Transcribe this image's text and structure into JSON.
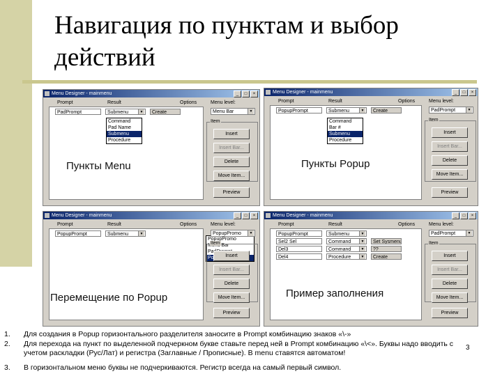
{
  "slide": {
    "title_line1": "Навигация по пунктам и выбор",
    "title_line2": "действий",
    "number": "3",
    "accent_color": "#d5d3a6",
    "rule_color": "#cac78e"
  },
  "windows": [
    {
      "title": "Menu Designer - mainmenu",
      "caption": "Пункты Menu",
      "labels": {
        "prompt": "Prompt",
        "result": "Result",
        "options": "Options",
        "menu_level": "Menu level:",
        "item": "Item"
      },
      "rows": [
        {
          "prompt": "PadPrompt",
          "result": "Submenu",
          "extra": "Create"
        }
      ],
      "dropdown": [
        "Command",
        "Pad Name",
        "Submenu",
        "Procedure"
      ],
      "dropdown_selected": 2,
      "menu_level_value": "Menu Bar",
      "buttons": [
        "Insert",
        "Insert Bar...",
        "Delete",
        "Move Item...",
        "Preview"
      ]
    },
    {
      "title": "Menu Designer - mainmenu",
      "caption": "Пункты Popup",
      "labels": {
        "prompt": "Prompt",
        "result": "Result",
        "options": "Options",
        "menu_level": "Menu level:",
        "item": "Item"
      },
      "rows": [
        {
          "prompt": "PopupPrompt",
          "result": "Submenu",
          "extra": "Create"
        }
      ],
      "dropdown": [
        "Command",
        "Bar #",
        "Submenu",
        "Procedure"
      ],
      "dropdown_selected": 2,
      "menu_level_value": "PadPrompt",
      "buttons": [
        "Insert",
        "Insert Bar...",
        "Delete",
        "Move Item...",
        "Preview"
      ]
    },
    {
      "title": "Menu Designer - mainmenu",
      "caption": "Перемещение по Popup",
      "labels": {
        "prompt": "Prompt",
        "result": "Result",
        "options": "Options",
        "menu_level": "Menu level:",
        "item": "Item"
      },
      "rows": [
        {
          "prompt": "PopupPrompt",
          "result": "Submenu",
          "extra": ""
        }
      ],
      "dropdown": [
        "PopupPromo",
        "Menu Bar",
        "PadPrompt",
        "PopupPromo"
      ],
      "dropdown_selected": 3,
      "menu_level_value": "PopupPromo",
      "buttons": [
        "Insert",
        "Insert Bar...",
        "Delete",
        "Move Item...",
        "Preview"
      ]
    },
    {
      "title": "Menu Designer - mainmenu",
      "caption": "Пример заполнения",
      "labels": {
        "prompt": "Prompt",
        "result": "Result",
        "options": "Options",
        "menu_level": "Menu level:",
        "item": "Item"
      },
      "rows": [
        {
          "prompt": "PopupPrompt",
          "result": "Submenu",
          "extra": ""
        },
        {
          "prompt": "Sel2 Sel",
          "result": "Command",
          "extra": "Set Sysmenu Defa"
        },
        {
          "prompt": "Del3",
          "result": "Command",
          "extra": "??"
        },
        {
          "prompt": "Del4",
          "result": "Procedure",
          "extra": "Create"
        }
      ],
      "dropdown": [],
      "dropdown_selected": -1,
      "menu_level_value": "PadPrompt",
      "buttons": [
        "Insert",
        "Insert Bar...",
        "Delete",
        "Move Item...",
        "Preview"
      ]
    }
  ],
  "notes": [
    {
      "num": "1.",
      "text": "Для создания в Popup горизонтального разделителя заносите в Prompt комбинацию знаков «\\-»"
    },
    {
      "num": "2.",
      "text": "Для перехода на пункт по выделенной подчеркном букве ставьте перед ней в Prompt комбинацию «\\<». Буквы надо вводить с учетом раскладки (Рус/Лат) и регистра (Заглавные / Прописные). В menu ставятся автоматом!"
    },
    {
      "num": "3.",
      "text": "В горизонтальном меню буквы не подчеркиваются. Регистр всегда на самый первый символ."
    }
  ]
}
